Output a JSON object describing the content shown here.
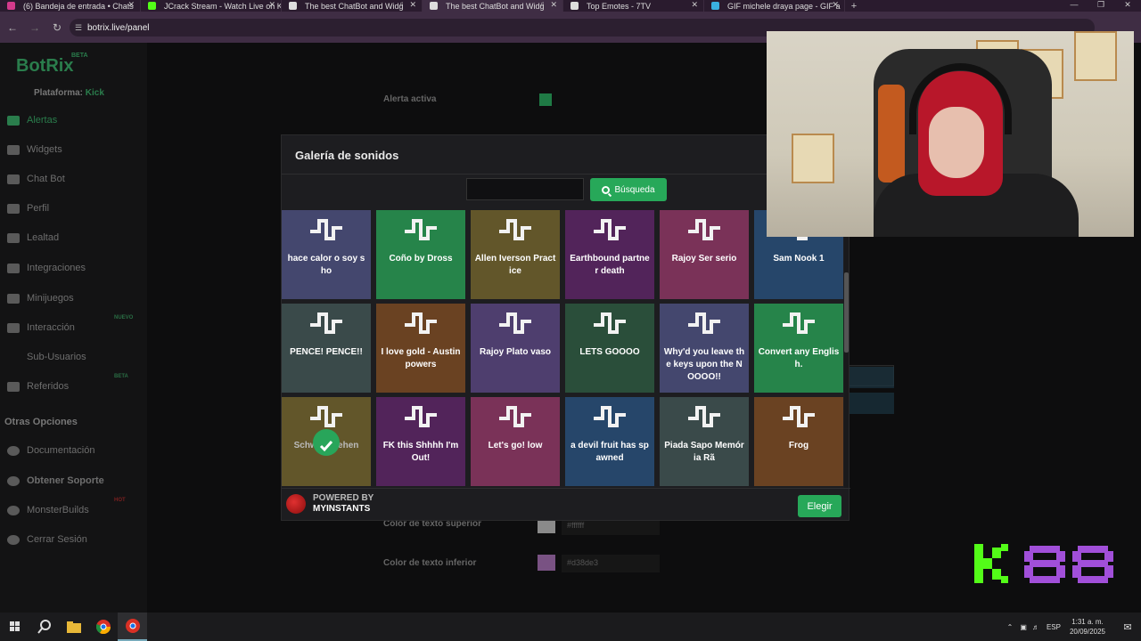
{
  "browser": {
    "tabs": [
      {
        "title": "(6) Bandeja de entrada • Chats",
        "favicon_color": "#d43a8c",
        "active": false
      },
      {
        "title": "JCrack Stream - Watch Live on K",
        "favicon_color": "#53fc18",
        "active": false
      },
      {
        "title": "The best ChatBot and Widg",
        "favicon_color": "#dddddd",
        "active": false
      },
      {
        "title": "The best ChatBot and Widg",
        "favicon_color": "#dddddd",
        "active": true
      },
      {
        "title": "Top Emotes - 7TV",
        "favicon_color": "#dddddd",
        "active": false
      },
      {
        "title": "GIF michele draya page - GIF a",
        "favicon_color": "#3ab0e0",
        "active": false
      }
    ],
    "url": "botrix.live/panel"
  },
  "sidebar": {
    "logo": "BotRix",
    "beta_badge": "BETA",
    "platform_label": "Plataforma:",
    "platform_value": "Kick",
    "items": [
      {
        "label": "Alertas",
        "icon": "alert-icon",
        "active": true,
        "tag": ""
      },
      {
        "label": "Widgets",
        "icon": "widgets-icon",
        "active": false,
        "tag": ""
      },
      {
        "label": "Chat Bot",
        "icon": "robot-icon",
        "active": false,
        "tag": ""
      },
      {
        "label": "Perfil",
        "icon": "profile-icon",
        "active": false,
        "tag": ""
      },
      {
        "label": "Lealtad",
        "icon": "trophy-icon",
        "active": false,
        "tag": ""
      },
      {
        "label": "Integraciones",
        "icon": "integrations-icon",
        "active": false,
        "tag": ""
      },
      {
        "label": "Minijuegos",
        "icon": "gamepad-icon",
        "active": false,
        "tag": ""
      },
      {
        "label": "Interacción",
        "icon": "music-icon",
        "active": false,
        "tag": "NUEVO"
      },
      {
        "label": "Sub-Usuarios",
        "icon": "",
        "active": false,
        "tag": ""
      },
      {
        "label": "Referidos",
        "icon": "users-icon",
        "active": false,
        "tag": "BETA"
      }
    ],
    "other_title": "Otras Opciones",
    "other_items": [
      {
        "label": "Documentación",
        "icon": "document-icon",
        "tag": ""
      },
      {
        "label": "Obtener Soporte",
        "icon": "support-icon",
        "tag": ""
      },
      {
        "label": "MonsterBuilds",
        "icon": "monitor-icon",
        "tag": "HOT"
      },
      {
        "label": "Cerrar Sesión",
        "icon": "logout-icon",
        "tag": ""
      }
    ]
  },
  "background": {
    "alert_active_label": "Alerta activa",
    "text_top_label": "Color de texto superior",
    "text_top_value": "#ffffff",
    "text_bottom_label": "Color de texto inferior",
    "text_bottom_value": "#d38de3",
    "text_bottom_color": "#d38de3"
  },
  "modal": {
    "title": "Galería de sonidos",
    "search_placeholder": "",
    "search_button": "Búsqueda",
    "tiles": [
      {
        "label": "hace calor o soy sho",
        "color": "#44476e"
      },
      {
        "label": "Coño by Dross",
        "color": "#26844a"
      },
      {
        "label": "Allen Iverson Practice",
        "color": "#62562a"
      },
      {
        "label": "Earthbound partner death",
        "color": "#52245a"
      },
      {
        "label": "Rajoy Ser serio",
        "color": "#7a3258"
      },
      {
        "label": "Sam Nook 1",
        "color": "#26466a"
      },
      {
        "label": "PENCE! PENCE!!",
        "color": "#3a4a4a"
      },
      {
        "label": "I love gold - Austin powers",
        "color": "#6a4222"
      },
      {
        "label": "Rajoy Plato vaso",
        "color": "#4e3e6e"
      },
      {
        "label": "LETS GOOOO",
        "color": "#2a4e3a"
      },
      {
        "label": "Why'd you leave the keys upon the NOOOO!!",
        "color": "#44476e"
      },
      {
        "label": "Convert any English.",
        "color": "#26844a"
      },
      {
        "label": "Schwert ziehen",
        "color": "#62562a",
        "selected": true
      },
      {
        "label": "FK this Shhhh I'm Out!",
        "color": "#52245a"
      },
      {
        "label": "Let's go! low",
        "color": "#7a3258"
      },
      {
        "label": "a devil fruit has spawned",
        "color": "#26466a"
      },
      {
        "label": "Piada Sapo Memória Rã",
        "color": "#3a4a4a"
      },
      {
        "label": "Frog",
        "color": "#6a4222"
      }
    ],
    "powered_line1": "POWERED BY",
    "powered_line2": "MYINSTANTS",
    "choose_button": "Elegir"
  },
  "taskbar": {
    "language": "ESP",
    "time": "1:31 a. m.",
    "date": "20/09/2025"
  }
}
